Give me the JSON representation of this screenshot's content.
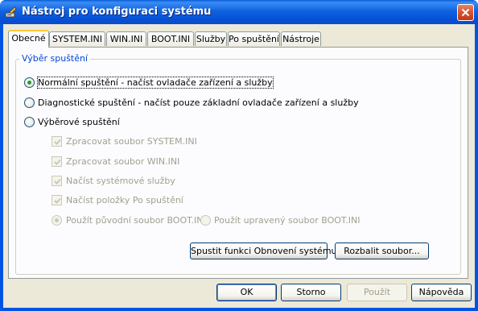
{
  "window": {
    "title": "Nástroj pro konfiguraci systému",
    "icon": "msconfig-app-icon",
    "close_icon": "close-icon"
  },
  "tabs": [
    {
      "label": "Obecné",
      "active": true
    },
    {
      "label": "SYSTEM.INI",
      "active": false
    },
    {
      "label": "WIN.INI",
      "active": false
    },
    {
      "label": "BOOT.INI",
      "active": false
    },
    {
      "label": "Služby",
      "active": false
    },
    {
      "label": "Po spuštění",
      "active": false
    },
    {
      "label": "Nástroje",
      "active": false
    }
  ],
  "startup_group": {
    "legend": "Výběr spuštění",
    "options": [
      {
        "label": "Normální spuštění - načíst ovladače zařízení a služby",
        "checked": true
      },
      {
        "label": "Diagnostické spuštění - načíst pouze základní ovladače zařízení a služby",
        "checked": false
      },
      {
        "label": "Výběrové spuštění",
        "checked": false
      }
    ],
    "selective_items": [
      {
        "label": "Zpracovat soubor SYSTEM.INI",
        "checked": true,
        "enabled": false
      },
      {
        "label": "Zpracovat soubor WIN.INI",
        "checked": true,
        "enabled": false
      },
      {
        "label": "Načíst systémové služby",
        "checked": true,
        "enabled": false
      },
      {
        "label": "Načíst položky Po spuštění",
        "checked": true,
        "enabled": false
      }
    ],
    "boot_options": [
      {
        "label": "Použít původní soubor BOOT.INI",
        "checked": true,
        "enabled": false
      },
      {
        "label": "Použít upravený soubor BOOT.INI",
        "checked": false,
        "enabled": false
      }
    ],
    "buttons": {
      "restore": "Spustit funkci Obnovení systému",
      "expand": "Rozbalit soubor..."
    }
  },
  "dialog_buttons": {
    "ok": "OK",
    "cancel": "Storno",
    "apply": "Použít",
    "help": "Nápověda"
  },
  "colors": {
    "titlebar": "#0054e3",
    "client_bg": "#ece9d8",
    "group_legend": "#0046d5",
    "disabled_text": "#a19f8f",
    "radio_dot": "#21a121"
  }
}
